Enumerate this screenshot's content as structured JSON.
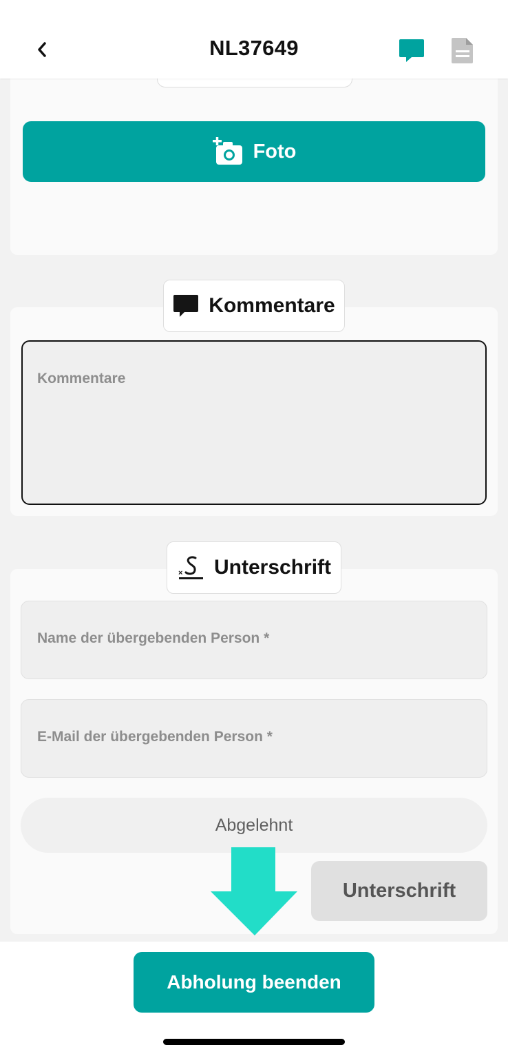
{
  "header": {
    "title": "NL37649",
    "back_icon": "chevron-left-icon",
    "chat_icon": "chat-bubble-icon",
    "document_icon": "document-icon"
  },
  "photo": {
    "button_label": "Foto",
    "icon": "add-photo-icon"
  },
  "comments": {
    "section_label": "Kommentare",
    "icon": "comment-icon",
    "placeholder": "Kommentare"
  },
  "signature": {
    "section_label": "Unterschrift",
    "icon": "signature-icon",
    "name_placeholder": "Name der übergebenden Person *",
    "email_placeholder": "E-Mail der übergebenden Person *",
    "declined_label": "Abgelehnt",
    "sign_button_label": "Unterschrift"
  },
  "footer": {
    "finish_button_label": "Abholung beenden"
  },
  "colors": {
    "accent": "#00a39f",
    "arrow": "#22ddc8"
  }
}
